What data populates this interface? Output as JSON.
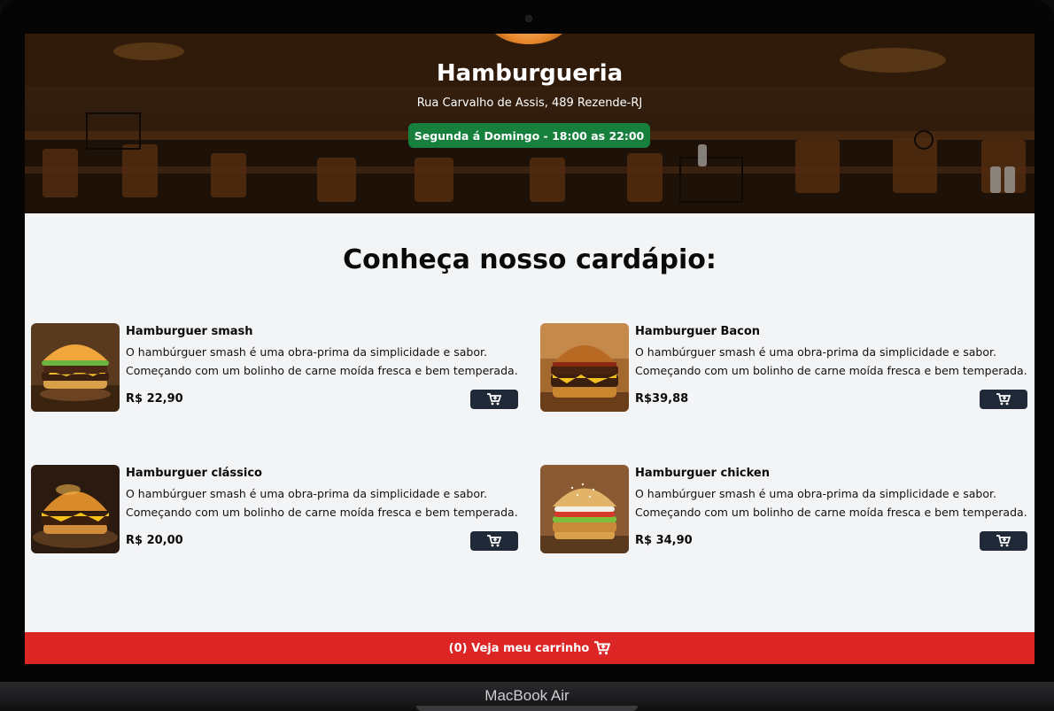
{
  "device": {
    "label": "MacBook Air"
  },
  "hero": {
    "title": "Hamburgueria",
    "address": "Rua Carvalho de Assis, 489 Rezende-RJ",
    "hours": "Segunda á Domingo - 18:00 as 22:00",
    "hours_color": "#16803c"
  },
  "menu": {
    "title": "Conheça nosso cardápio:",
    "items": [
      {
        "name": "Hamburguer smash",
        "description": "O hambúrguer smash é uma obra-prima da simplicidade e sabor. Começando com um bolinho de carne moída fresca e bem temperada.",
        "price": "R$ 22,90",
        "icon": "cart-plus-icon"
      },
      {
        "name": "Hamburguer Bacon",
        "description": "O hambúrguer smash é uma obra-prima da simplicidade e sabor. Começando com um bolinho de carne moída fresca e bem temperada.",
        "price": "R$39,88",
        "icon": "cart-plus-icon"
      },
      {
        "name": "Hamburguer clássico",
        "description": "O hambúrguer smash é uma obra-prima da simplicidade e sabor. Começando com um bolinho de carne moída fresca e bem temperada.",
        "price": "R$ 20,00",
        "icon": "cart-plus-icon"
      },
      {
        "name": "Hamburguer chicken",
        "description": "O hambúrguer smash é uma obra-prima da simplicidade e sabor. Começando com um bolinho de carne moída fresca e bem temperada.",
        "price": "R$ 34,90",
        "icon": "cart-plus-icon"
      }
    ]
  },
  "footer": {
    "cart_label": "(0) Veja meu carrinho",
    "cart_icon": "cart-plus-icon",
    "color": "#dc2626"
  }
}
